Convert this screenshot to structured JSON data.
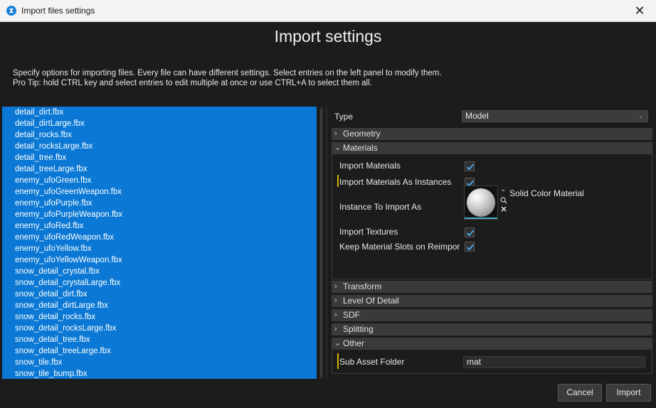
{
  "window": {
    "title": "Import files settings",
    "close_symbol": "✕"
  },
  "heading": "Import settings",
  "description": {
    "line1": "Specify options for importing files. Every file can have different settings. Select entries on the left panel to modify them.",
    "line2": "Pro Tip: hold CTRL key and select entries to edit multiple at once or use CTRL+A to select them all."
  },
  "files": [
    "detail_dirt.fbx",
    "detail_dirtLarge.fbx",
    "detail_rocks.fbx",
    "detail_rocksLarge.fbx",
    "detail_tree.fbx",
    "detail_treeLarge.fbx",
    "enemy_ufoGreen.fbx",
    "enemy_ufoGreenWeapon.fbx",
    "enemy_ufoPurple.fbx",
    "enemy_ufoPurpleWeapon.fbx",
    "enemy_ufoRed.fbx",
    "enemy_ufoRedWeapon.fbx",
    "enemy_ufoYellow.fbx",
    "enemy_ufoYellowWeapon.fbx",
    "snow_detail_crystal.fbx",
    "snow_detail_crystalLarge.fbx",
    "snow_detail_dirt.fbx",
    "snow_detail_dirtLarge.fbx",
    "snow_detail_rocks.fbx",
    "snow_detail_rocksLarge.fbx",
    "snow_detail_tree.fbx",
    "snow_detail_treeLarge.fbx",
    "snow_tile.fbx",
    "snow_tile_bump.fbx"
  ],
  "properties": {
    "type_label": "Type",
    "type_value": "Model",
    "groups": {
      "geometry": "Geometry",
      "materials": "Materials",
      "transform": "Transform",
      "lod": "Level Of Detail",
      "sdf": "SDF",
      "splitting": "Splitting",
      "other": "Other"
    },
    "materials": {
      "import_materials": "Import Materials",
      "import_as_instances": "Import Materials As Instances",
      "instance_to_import_as": "Instance To Import As",
      "instance_value": "Solid Color Material",
      "import_textures": "Import Textures",
      "keep_material_slots": "Keep Material Slots on Reimpor"
    },
    "other": {
      "sub_asset_folder_label": "Sub Asset Folder",
      "sub_asset_folder_value": "mat"
    }
  },
  "buttons": {
    "cancel": "Cancel",
    "import": "Import"
  },
  "colors": {
    "selection": "#0a78d4",
    "accent_check": "#4aa3e0",
    "modified_marker": "#d8b500"
  }
}
